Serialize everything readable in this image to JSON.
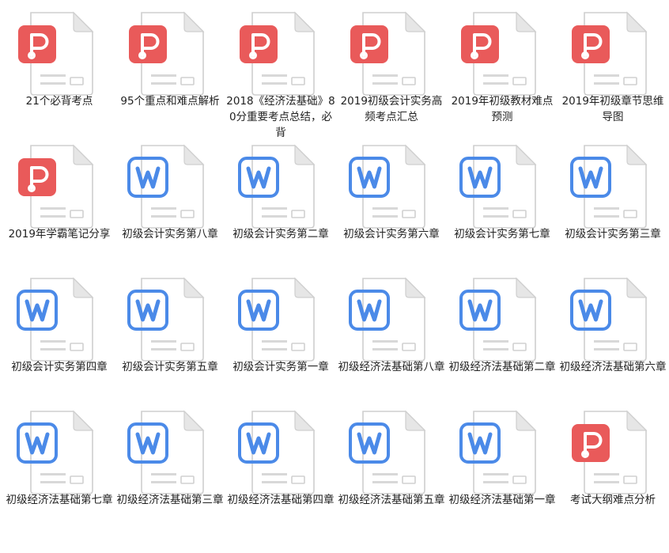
{
  "files": [
    {
      "name": "21个必背考点",
      "type": "pdf"
    },
    {
      "name": "95个重点和难点解析",
      "type": "pdf"
    },
    {
      "name": "2018《经济法基础》80分重要考点总结，必背",
      "type": "pdf"
    },
    {
      "name": "2019初级会计实务高频考点汇总",
      "type": "pdf"
    },
    {
      "name": "2019年初级教材难点预测",
      "type": "pdf"
    },
    {
      "name": "2019年初级章节思维导图",
      "type": "pdf"
    },
    {
      "name": "2019年学霸笔记分享",
      "type": "pdf"
    },
    {
      "name": "初级会计实务第八章",
      "type": "word"
    },
    {
      "name": "初级会计实务第二章",
      "type": "word"
    },
    {
      "name": "初级会计实务第六章",
      "type": "word"
    },
    {
      "name": "初级会计实务第七章",
      "type": "word"
    },
    {
      "name": "初级会计实务第三章",
      "type": "word"
    },
    {
      "name": "初级会计实务第四章",
      "type": "word"
    },
    {
      "name": "初级会计实务第五章",
      "type": "word"
    },
    {
      "name": "初级会计实务第一章",
      "type": "word"
    },
    {
      "name": "初级经济法基础第八章",
      "type": "word"
    },
    {
      "name": "初级经济法基础第二章",
      "type": "word"
    },
    {
      "name": "初级经济法基础第六章",
      "type": "word"
    },
    {
      "name": "初级经济法基础第七章",
      "type": "word"
    },
    {
      "name": "初级经济法基础第三章",
      "type": "word"
    },
    {
      "name": "初级经济法基础第四章",
      "type": "word"
    },
    {
      "name": "初级经济法基础第五章",
      "type": "word"
    },
    {
      "name": "初级经济法基础第一章",
      "type": "word"
    },
    {
      "name": "考试大纲难点分析",
      "type": "pdf"
    }
  ],
  "icons": {
    "pdf": {
      "name": "pdf-file-icon",
      "color": "#e95a5a"
    },
    "word": {
      "name": "word-file-icon",
      "color": "#4b8ae8"
    }
  }
}
